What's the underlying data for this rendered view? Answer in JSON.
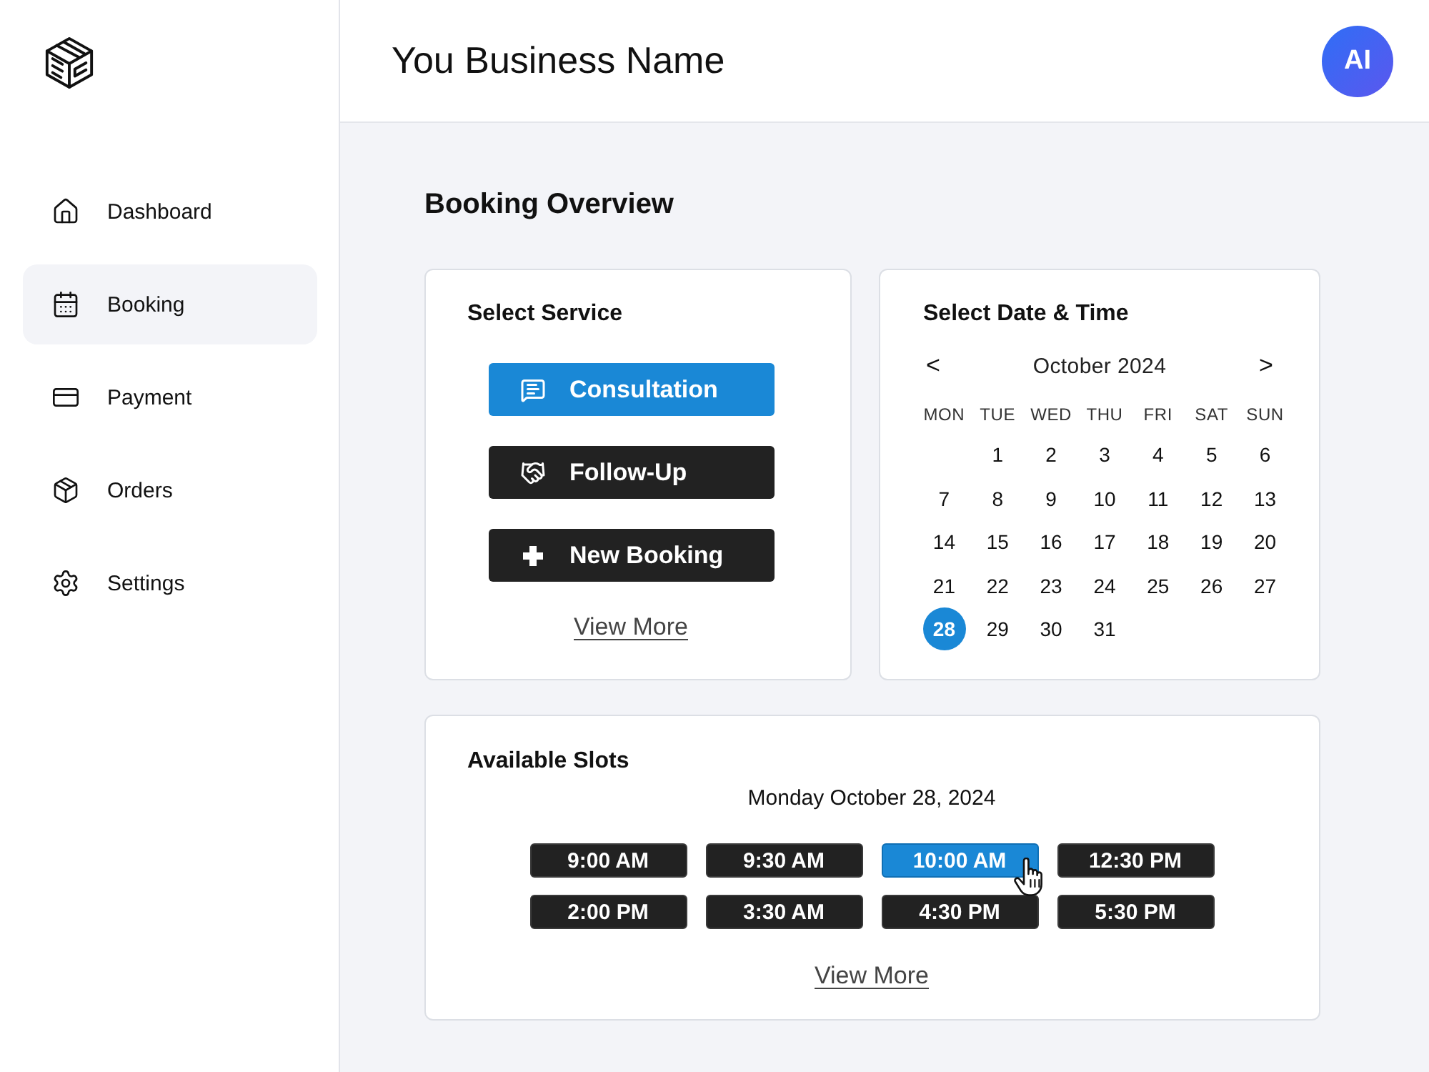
{
  "sidebar": {
    "items": [
      {
        "label": "Dashboard",
        "selected": false
      },
      {
        "label": "Booking",
        "selected": true
      },
      {
        "label": "Payment",
        "selected": false
      },
      {
        "label": "Orders",
        "selected": false
      },
      {
        "label": "Settings",
        "selected": false
      }
    ]
  },
  "header": {
    "title": "You Business Name",
    "avatar": "AI"
  },
  "page_title": "Booking Overview",
  "service_card": {
    "title": "Select Service",
    "services": [
      {
        "label": "Consultation",
        "selected": true
      },
      {
        "label": "Follow-Up",
        "selected": false
      },
      {
        "label": "New Booking",
        "selected": false
      }
    ],
    "view_more": "View More"
  },
  "calendar_card": {
    "title": "Select Date & Time",
    "prev": "<",
    "month": "October 2024",
    "next": ">",
    "weekdays": [
      "MON",
      "TUE",
      "WED",
      "THU",
      "FRI",
      "SAT",
      "SUN"
    ],
    "weeks": [
      [
        {
          "label": "1",
          "selected": false
        },
        {
          "label": "2",
          "selected": false
        },
        {
          "label": "3",
          "selected": false
        },
        {
          "label": "4",
          "selected": false
        },
        {
          "label": "5",
          "selected": false
        },
        {
          "label": "6",
          "selected": false
        }
      ],
      [
        {
          "label": "7",
          "selected": false
        },
        {
          "label": "8",
          "selected": false
        },
        {
          "label": "9",
          "selected": false
        },
        {
          "label": "10",
          "selected": false
        },
        {
          "label": "11",
          "selected": false
        },
        {
          "label": "12",
          "selected": false
        },
        {
          "label": "13",
          "selected": false
        }
      ],
      [
        {
          "label": "14",
          "selected": false
        },
        {
          "label": "15",
          "selected": false
        },
        {
          "label": "16",
          "selected": false
        },
        {
          "label": "17",
          "selected": false
        },
        {
          "label": "18",
          "selected": false
        },
        {
          "label": "19",
          "selected": false
        },
        {
          "label": "20",
          "selected": false
        }
      ],
      [
        {
          "label": "21",
          "selected": false
        },
        {
          "label": "22",
          "selected": false
        },
        {
          "label": "23",
          "selected": false
        },
        {
          "label": "24",
          "selected": false
        },
        {
          "label": "25",
          "selected": false
        },
        {
          "label": "26",
          "selected": false
        },
        {
          "label": "27",
          "selected": false
        }
      ],
      [
        {
          "label": "28",
          "selected": true
        },
        {
          "label": "29",
          "selected": false
        },
        {
          "label": "30",
          "selected": false
        },
        {
          "label": "31",
          "selected": false
        }
      ]
    ]
  },
  "slots_card": {
    "title": "Available Slots",
    "date": "Monday October 28, 2024",
    "slots": [
      {
        "label": "9:00 AM",
        "selected": false,
        "hovered": false
      },
      {
        "label": "9:30 AM",
        "selected": false,
        "hovered": false
      },
      {
        "label": "10:00 AM",
        "selected": true,
        "hovered": true
      },
      {
        "label": "12:30 PM",
        "selected": false,
        "hovered": false
      },
      {
        "label": "2:00 PM",
        "selected": false,
        "hovered": false
      },
      {
        "label": "3:30 AM",
        "selected": false,
        "hovered": false
      },
      {
        "label": "4:30 PM",
        "selected": false,
        "hovered": false
      },
      {
        "label": "5:30 PM",
        "selected": false,
        "hovered": false
      }
    ],
    "view_more": "View More"
  }
}
